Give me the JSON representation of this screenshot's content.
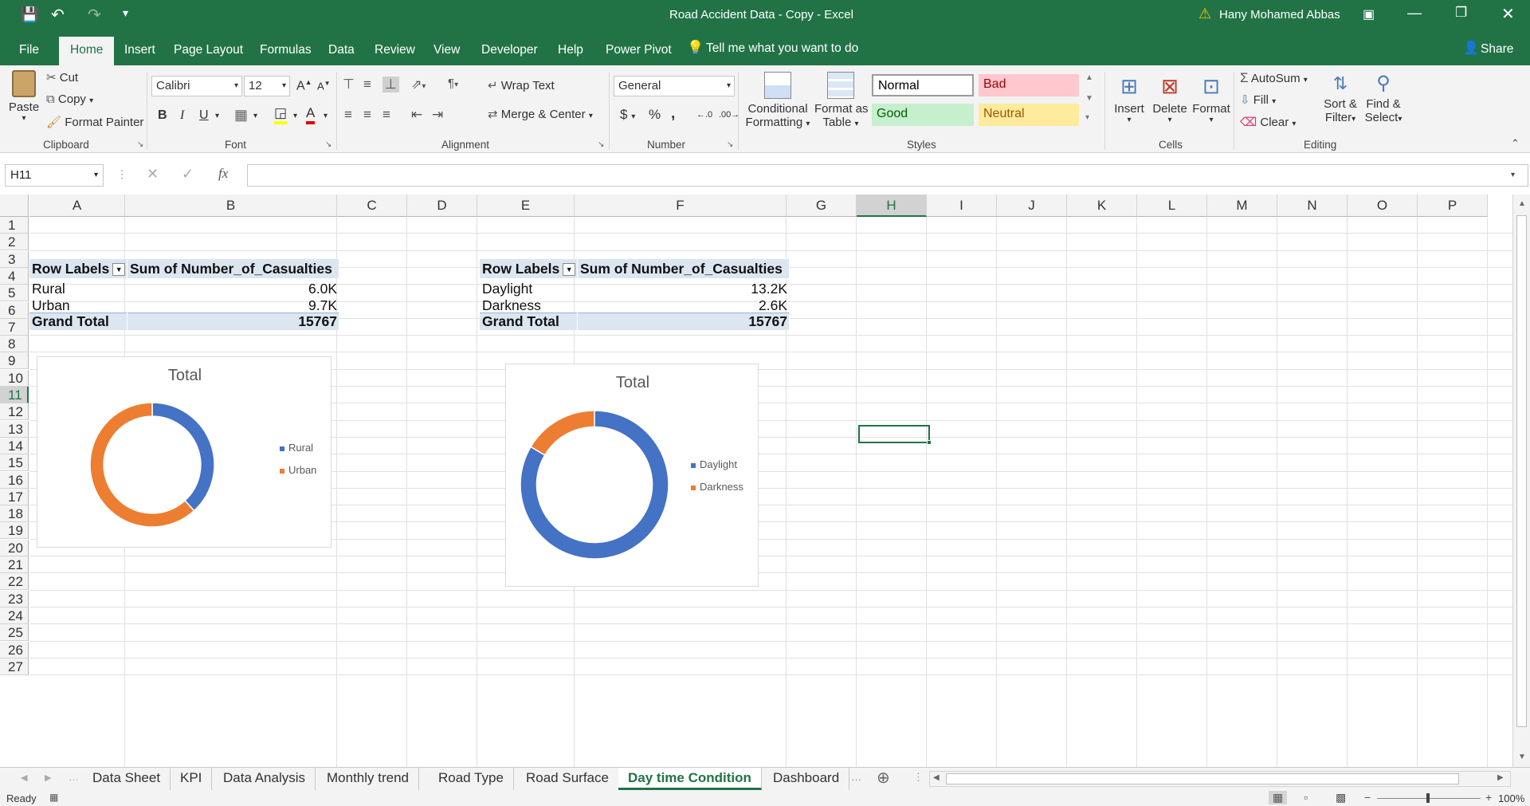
{
  "window": {
    "title": "Road Accident Data - Copy  -  Excel",
    "user": "Hany Mohamed Abbas",
    "share": "Share"
  },
  "ribbon_tabs": [
    "File",
    "Home",
    "Insert",
    "Page Layout",
    "Formulas",
    "Data",
    "Review",
    "View",
    "Developer",
    "Help",
    "Power Pivot"
  ],
  "tell_me": "Tell me what you want to do",
  "clipboard": {
    "paste": "Paste",
    "cut": "Cut",
    "copy": "Copy",
    "format_painter": "Format Painter",
    "label": "Clipboard"
  },
  "font": {
    "name": "Calibri",
    "size": "12",
    "label": "Font",
    "bold": "B",
    "italic": "I",
    "underline": "U"
  },
  "alignment": {
    "wrap": "Wrap Text",
    "merge": "Merge & Center",
    "label": "Alignment"
  },
  "number": {
    "format": "General",
    "currency": "$",
    "percent": "%",
    "comma": ",",
    "label": "Number"
  },
  "styles": {
    "cond1": "Conditional",
    "cond2": "Formatting",
    "fmt1": "Format as",
    "fmt2": "Table",
    "normal": "Normal",
    "bad": "Bad",
    "good": "Good",
    "neutral": "Neutral",
    "label": "Styles"
  },
  "cells": {
    "insert": "Insert",
    "delete": "Delete",
    "format": "Format",
    "label": "Cells"
  },
  "editing": {
    "autosum": "AutoSum",
    "fill": "Fill",
    "clear": "Clear",
    "sort1": "Sort &",
    "sort2": "Filter",
    "find1": "Find &",
    "find2": "Select",
    "label": "Editing"
  },
  "formula_bar": {
    "name_box": "H11",
    "fx": "fx",
    "formula": ""
  },
  "columns": [
    "A",
    "B",
    "C",
    "D",
    "E",
    "F",
    "G",
    "H",
    "I",
    "J",
    "K",
    "L",
    "M",
    "N",
    "O",
    "P"
  ],
  "rows": [
    "1",
    "2",
    "3",
    "4",
    "5",
    "6",
    "7",
    "8",
    "9",
    "10",
    "11",
    "12",
    "13",
    "14",
    "15",
    "16",
    "17",
    "18",
    "19",
    "20",
    "21",
    "22",
    "23",
    "24",
    "25",
    "26",
    "27"
  ],
  "pivot1": {
    "header": [
      "Row Labels",
      "Sum of Number_of_Casualties"
    ],
    "rows": [
      [
        "Rural",
        "6.0K"
      ],
      [
        "Urban",
        "9.7K"
      ]
    ],
    "total": [
      "Grand Total",
      "15767"
    ]
  },
  "pivot2": {
    "header": [
      "Row Labels",
      "Sum of Number_of_Casualties"
    ],
    "rows": [
      [
        "Daylight",
        "13.2K"
      ],
      [
        "Darkness",
        "2.6K"
      ]
    ],
    "total": [
      "Grand Total",
      "15767"
    ]
  },
  "chart_data": [
    {
      "type": "pie",
      "title": "Total",
      "categories": [
        "Rural",
        "Urban"
      ],
      "values": [
        6000,
        9700
      ],
      "colors": [
        "#4472c4",
        "#ed7d31"
      ],
      "legend": "right",
      "donut": true
    },
    {
      "type": "pie",
      "title": "Total",
      "categories": [
        "Daylight",
        "Darkness"
      ],
      "values": [
        13200,
        2600
      ],
      "colors": [
        "#4472c4",
        "#ed7d31"
      ],
      "legend": "right",
      "donut": true
    }
  ],
  "sheet_tabs": [
    "Data Sheet",
    "KPI",
    "Data Analysis",
    "Monthly trend",
    "Road Type",
    "Road Surface",
    "Day time Condition",
    "Dashboard"
  ],
  "active_sheet": "Day time Condition",
  "status": {
    "ready": "Ready",
    "zoom": "100%"
  }
}
